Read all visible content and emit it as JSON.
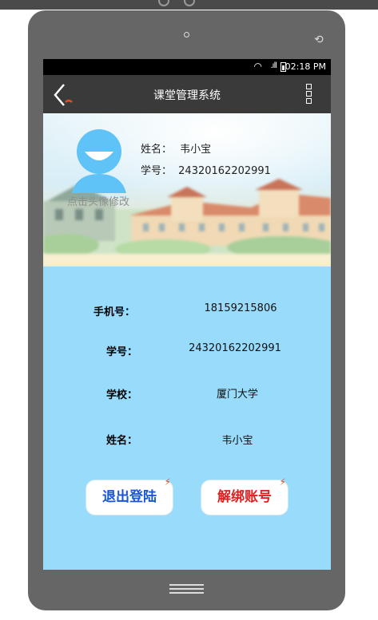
{
  "status_bar": {
    "time": "02:18 PM"
  },
  "nav": {
    "title": "课堂管理系统"
  },
  "profile": {
    "avatar_hint": "点击头像修改",
    "name_label": "姓名：",
    "name_value": "韦小宝",
    "student_id_label": "学号：",
    "student_id_value": "24320162202991"
  },
  "details": [
    {
      "label": "手机号：",
      "value": "18159215806"
    },
    {
      "label": "学号：",
      "value": "24320162202991"
    },
    {
      "label": "学校：",
      "value": "厦门大学"
    },
    {
      "label": "姓名：",
      "value": "韦小宝"
    }
  ],
  "buttons": {
    "logout": "退出登陆",
    "unbind": "解绑账号"
  },
  "colors": {
    "screen_bg": "#99dbfb",
    "logout_text": "#1a55d8",
    "unbind_text": "#e02020",
    "navbar": "#3a3a3a"
  }
}
